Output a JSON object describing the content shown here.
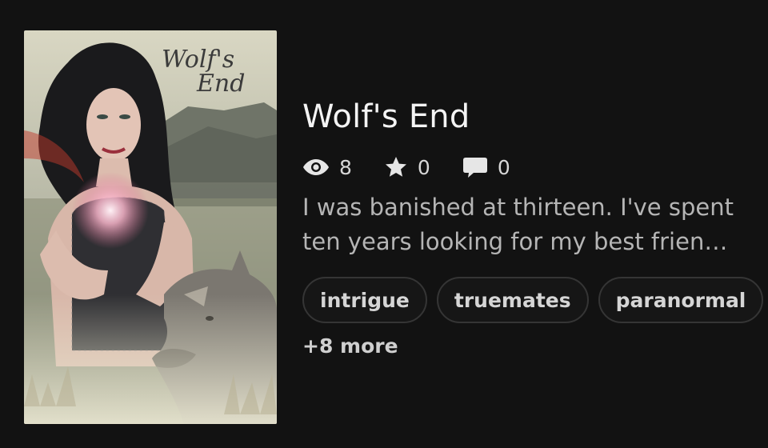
{
  "story": {
    "cover_title_line1": "Wolf's",
    "cover_title_line2": "End",
    "title": "Wolf's End",
    "stats": {
      "reads": "8",
      "votes": "0",
      "comments": "0"
    },
    "description": "I was banished at thirteen. I've spent ten years looking for my best frien…",
    "tags": [
      "intrigue",
      "truemates",
      "paranormal"
    ],
    "more_tags": "+8 more"
  },
  "icons": {
    "reads": "eye-icon",
    "votes": "star-icon",
    "comments": "speech-bubble-icon"
  },
  "colors": {
    "background": "#121212",
    "tag_border": "#353535"
  }
}
